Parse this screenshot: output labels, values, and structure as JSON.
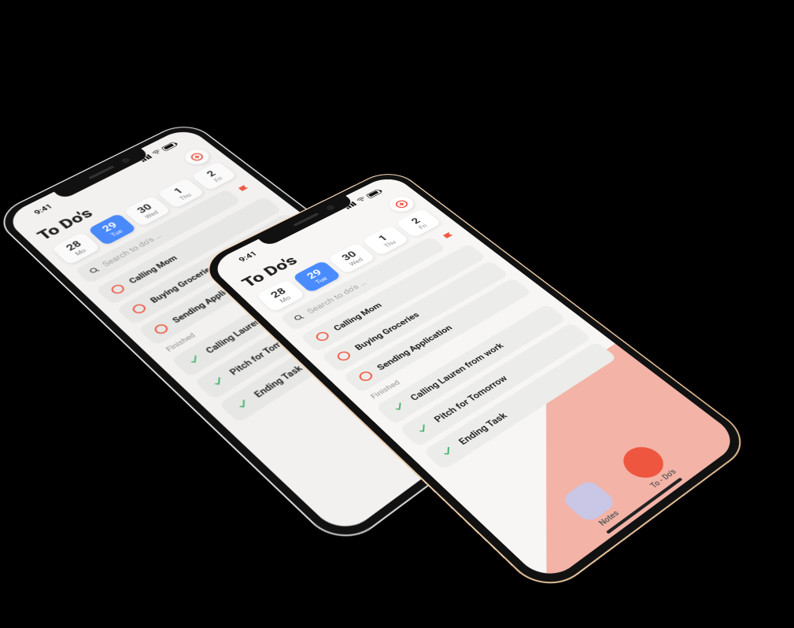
{
  "status": {
    "time": "9:41"
  },
  "header": {
    "title": "To Do's"
  },
  "dates": [
    {
      "num": "28",
      "day": "Mo",
      "active": false
    },
    {
      "num": "29",
      "day": "Tue",
      "active": true
    },
    {
      "num": "30",
      "day": "Wed",
      "active": false
    },
    {
      "num": "1",
      "day": "Thu",
      "active": false
    },
    {
      "num": "2",
      "day": "Fri",
      "active": false
    }
  ],
  "search": {
    "placeholder": "Search to do's …"
  },
  "todos": [
    {
      "label": "Calling Mom"
    },
    {
      "label": "Buying Groceries"
    },
    {
      "label": "Sending Application"
    }
  ],
  "finished_label": "Finished",
  "finished": [
    {
      "label": "Calling Lauren from work"
    },
    {
      "label": "Pitch for Tomorrow"
    },
    {
      "label": "Ending Task"
    }
  ],
  "nav": {
    "notes": "Notes",
    "todos": "To - Do's"
  },
  "colors": {
    "accent": "#4a8cff",
    "primary_action": "#f04a38",
    "done": "#3fb36a",
    "diag": "#f3b3a6"
  }
}
